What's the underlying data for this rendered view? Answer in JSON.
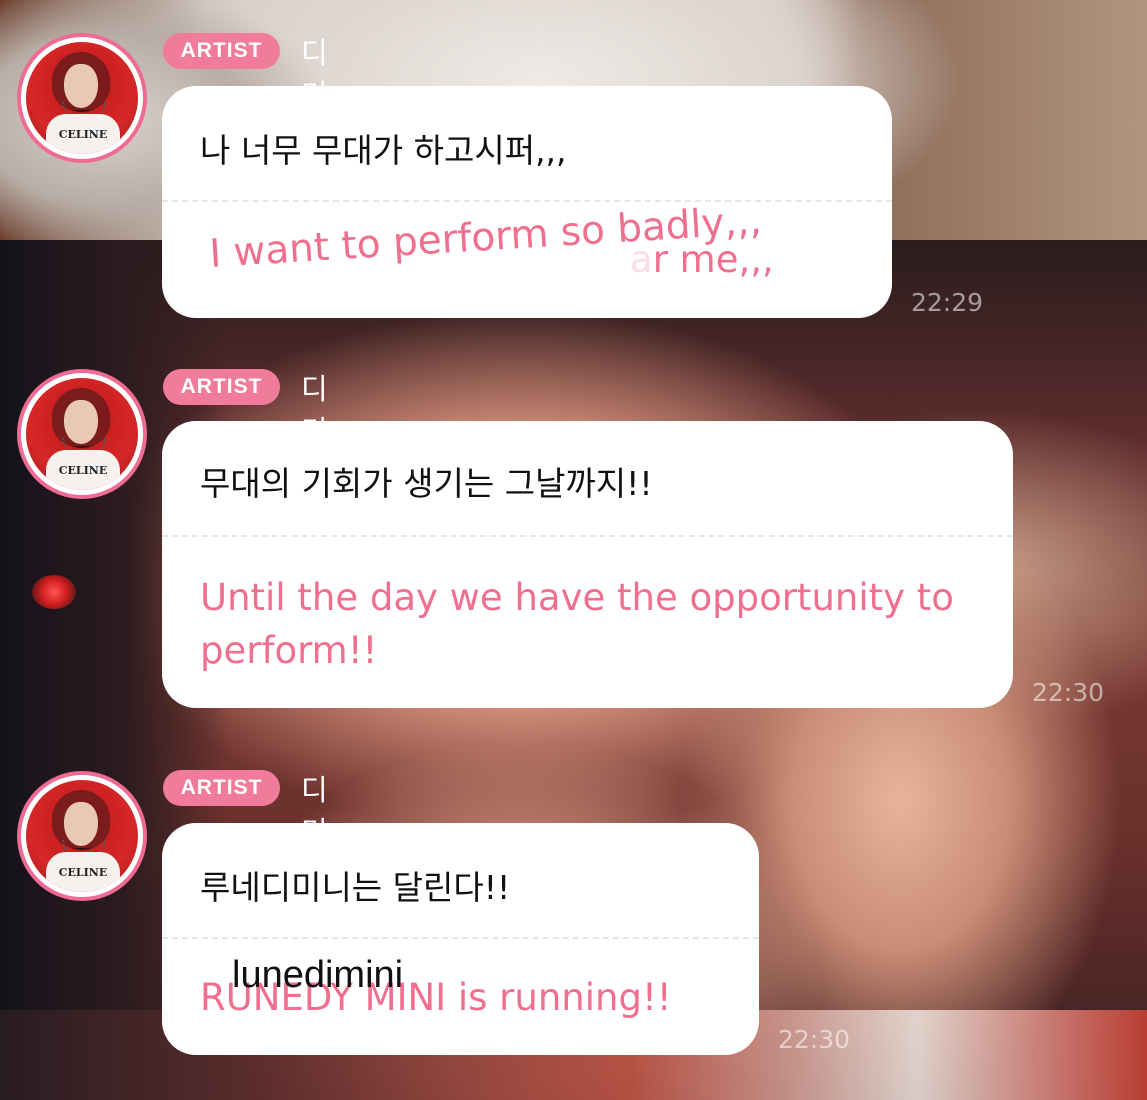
{
  "messages": [
    {
      "badge": "ARTIST",
      "sender": "디미니",
      "text_ko": "나 너무 무대가 하고시퍼,,,",
      "translation_overlay": "I want to perform so badly,,,",
      "translation_partial_faint": "a",
      "translation_partial": "r me,,,",
      "time": "22:29"
    },
    {
      "badge": "ARTIST",
      "sender": "디미니",
      "text_ko": "무대의 기회가 생기는 그날까지!!",
      "translation": "Until the day we have the opportunity to perform!!",
      "time": "22:30"
    },
    {
      "badge": "ARTIST",
      "sender": "디미니",
      "text_ko": "루네디미니는 달린다!!",
      "translation": "RUNEDY MINI is running!!",
      "correction_overlay": "lunedimini",
      "time": "22:30"
    }
  ],
  "avatar": {
    "shirt_text": "CELINE"
  },
  "colors": {
    "accent_pink": "#f06b93",
    "badge_pink": "#f07b9b",
    "translation_pink": "#f06f8e"
  }
}
